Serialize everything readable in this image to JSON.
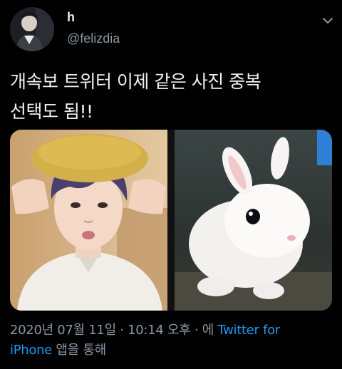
{
  "author": {
    "display_name": "h",
    "handle": "@felizdia"
  },
  "tweet": {
    "line1": "개속보 트위터 이제 같은 사진 중복",
    "line2": "선택도 됨!!"
  },
  "media": {
    "left_photo": "person-in-yellow-beret",
    "right_photo": "white-rabbit"
  },
  "meta": {
    "date": "2020년 07월 11일",
    "sep1": " · ",
    "time": "10:14 오후",
    "sep2": " · 에 ",
    "source_part1": "Twitter for",
    "source_part2": "iPhone",
    "suffix": " 앱을 통해"
  },
  "colors": {
    "background": "#000000",
    "link": "#1d9bf0",
    "secondary_text": "#8b98a5"
  }
}
